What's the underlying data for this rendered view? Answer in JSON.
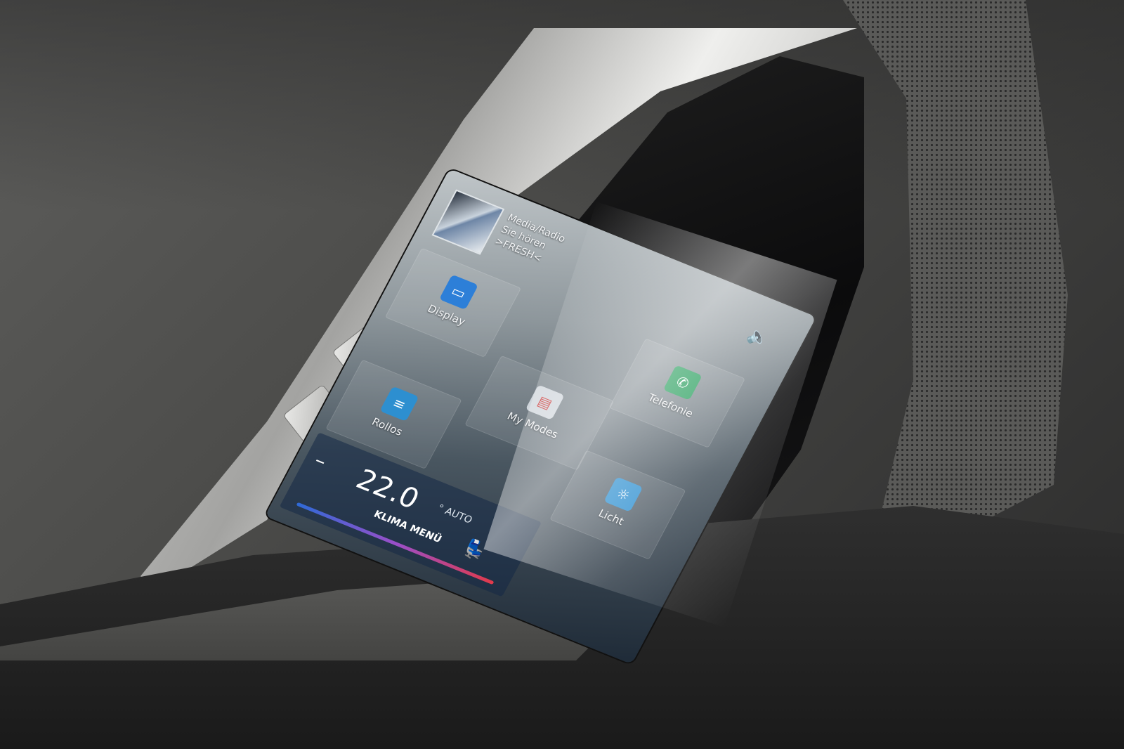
{
  "screen": {
    "media": {
      "title": "Media/Radio",
      "subtitle": "Sie hören",
      "station": ">FRESH<",
      "speaker_icon": "speaker-icon"
    },
    "tiles": {
      "display": {
        "label": "Display",
        "icon": "display-settings-icon",
        "color": "#2d7fd8"
      },
      "telefonie": {
        "label": "Telefonie",
        "icon": "phone-icon",
        "color": "#1f9a56"
      },
      "my_modes": {
        "label": "My Modes",
        "icon": "modes-icon",
        "color": "#cfd5db"
      },
      "rollos": {
        "label": "Rollos",
        "icon": "blinds-icon",
        "color": "#2d8fd0"
      },
      "licht": {
        "label": "Licht",
        "icon": "light-icon",
        "color": "#2d8fd0"
      }
    },
    "climate": {
      "minus_label": "–",
      "temperature": "22.0",
      "mode": "° AUTO",
      "menu_label": "KLIMA MENÜ",
      "seat_icon": "seat-heating-icon"
    }
  },
  "door_controls": {
    "window_button_icon": "window-icon",
    "unlock_button_icon": "unlock-icon",
    "lock_button_icon": "lock-icon"
  }
}
